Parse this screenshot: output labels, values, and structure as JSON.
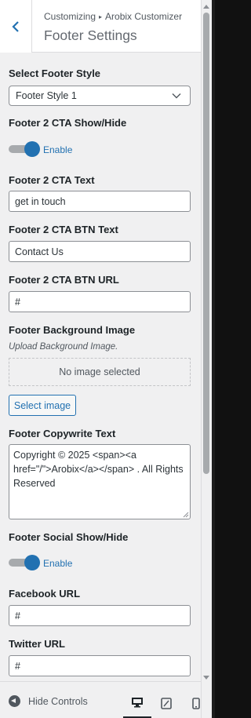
{
  "header": {
    "back_label": "Back",
    "breadcrumb_parent": "Customizing",
    "breadcrumb_separator": "▸",
    "breadcrumb_section": "Arobix Customizer",
    "title": "Footer Settings"
  },
  "controls": {
    "footer_style": {
      "label": "Select Footer Style",
      "value": "Footer Style 1"
    },
    "cta_toggle": {
      "label": "Footer 2 CTA Show/Hide",
      "state_label": "Enable",
      "enabled": true
    },
    "cta_text": {
      "label": "Footer 2 CTA Text",
      "value": "get in touch"
    },
    "cta_btn_text": {
      "label": "Footer 2 CTA BTN Text",
      "value": "Contact Us"
    },
    "cta_btn_url": {
      "label": "Footer 2 CTA BTN URL",
      "value": "#"
    },
    "bg_image": {
      "label": "Footer Background Image",
      "description": "Upload Background Image.",
      "empty_text": "No image selected",
      "button_label": "Select image"
    },
    "copyright": {
      "label": "Footer Copywrite Text",
      "value": "Copyright © 2025 <span><a href=\"/\">Arobix</a></span> . All Rights Reserved"
    },
    "social_toggle": {
      "label": "Footer Social Show/Hide",
      "state_label": "Enable",
      "enabled": true
    },
    "facebook_url": {
      "label": "Facebook URL",
      "value": "#"
    },
    "twitter_url": {
      "label": "Twitter URL",
      "value": "#"
    }
  },
  "footer": {
    "hide_controls_label": "Hide Controls",
    "devices": [
      "desktop",
      "tablet",
      "mobile"
    ],
    "active_device": "desktop"
  },
  "colors": {
    "accent": "#2271b1",
    "panel_bg": "#f0f0f1",
    "text": "#1d2327"
  }
}
